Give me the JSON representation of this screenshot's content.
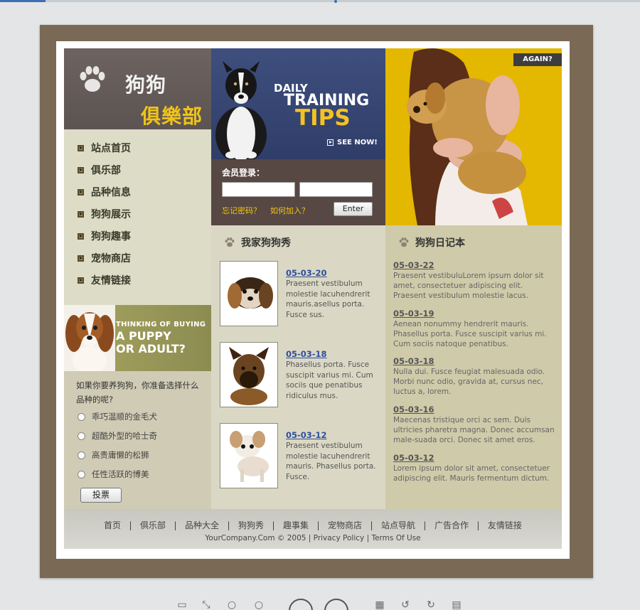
{
  "logo": {
    "line1": "狗狗",
    "line2": "俱樂部"
  },
  "nav": {
    "items": [
      "站点首页",
      "俱乐部",
      "品种信息",
      "狗狗展示",
      "狗狗趣事",
      "宠物商店",
      "友情链接"
    ]
  },
  "puppy_banner": {
    "line1": "THINKING OF BUYING",
    "line2": "A PUPPY",
    "line3": "OR ADULT?"
  },
  "poll": {
    "question": "如果你要养狗狗，你准备选择什么品种的呢?",
    "options": [
      "乖巧温顺的金毛犬",
      "超酷外型的哈士奇",
      "高贵庸懒的松狮",
      "任性活跃的博美"
    ],
    "vote_label": "投票"
  },
  "tips": {
    "daily": "DAILY",
    "training": "TRAINING",
    "tips": "TIPS",
    "see_now": "SEE NOW!"
  },
  "login": {
    "title": "会员登录：",
    "forgot": "忘记密码？",
    "join": "如何加入？",
    "enter": "Enter"
  },
  "photo": {
    "badge": "AGAIN?"
  },
  "dogshow": {
    "title": "我家狗狗秀",
    "items": [
      {
        "date": "05-03-20",
        "text": "Praesent vestibulum molestie lacuhendrerit mauris.asellus porta. Fusce sus."
      },
      {
        "date": "05-03-18",
        "text": "Phasellus porta. Fusce suscipit varius mi. Cum sociis que penatibus ridiculus mus."
      },
      {
        "date": "05-03-12",
        "text": "Praesent vestibulum molestie lacuhendrerit mauris. Phasellus porta. Fusce."
      }
    ]
  },
  "diary": {
    "title": "狗狗日记本",
    "items": [
      {
        "date": "05-03-22",
        "text": "Praesent vestibuluLorem ipsum dolor sit amet, consectetuer adipiscing elit. Praesent vestibulum molestie lacus."
      },
      {
        "date": "05-03-19",
        "text": "Aenean nonummy hendrerit mauris. Phasellus porta. Fusce suscipit varius mi. Cum sociis natoque penatibus."
      },
      {
        "date": "05-03-18",
        "text": "Nulla dui. Fusce feugiat malesuada odio. Morbi nunc odio, gravida at, cursus nec, luctus a, lorem."
      },
      {
        "date": "05-03-16",
        "text": "Maecenas tristique orci ac sem. Duis ultricies pharetra magna. Donec accumsan male-suada orci. Donec sit amet eros."
      },
      {
        "date": "05-03-12",
        "text": "Lorem ipsum dolor sit amet, consectetuer adipiscing elit. Mauris fermentum dictum."
      }
    ]
  },
  "footer": {
    "links": [
      "首页",
      "俱乐部",
      "品种大全",
      "狗狗秀",
      "趣事集",
      "宠物商店",
      "站点导航",
      "广告合作",
      "友情链接"
    ],
    "copyright": "YourCompany.Com © 2005 | Privacy Policy | Terms Of Use"
  }
}
